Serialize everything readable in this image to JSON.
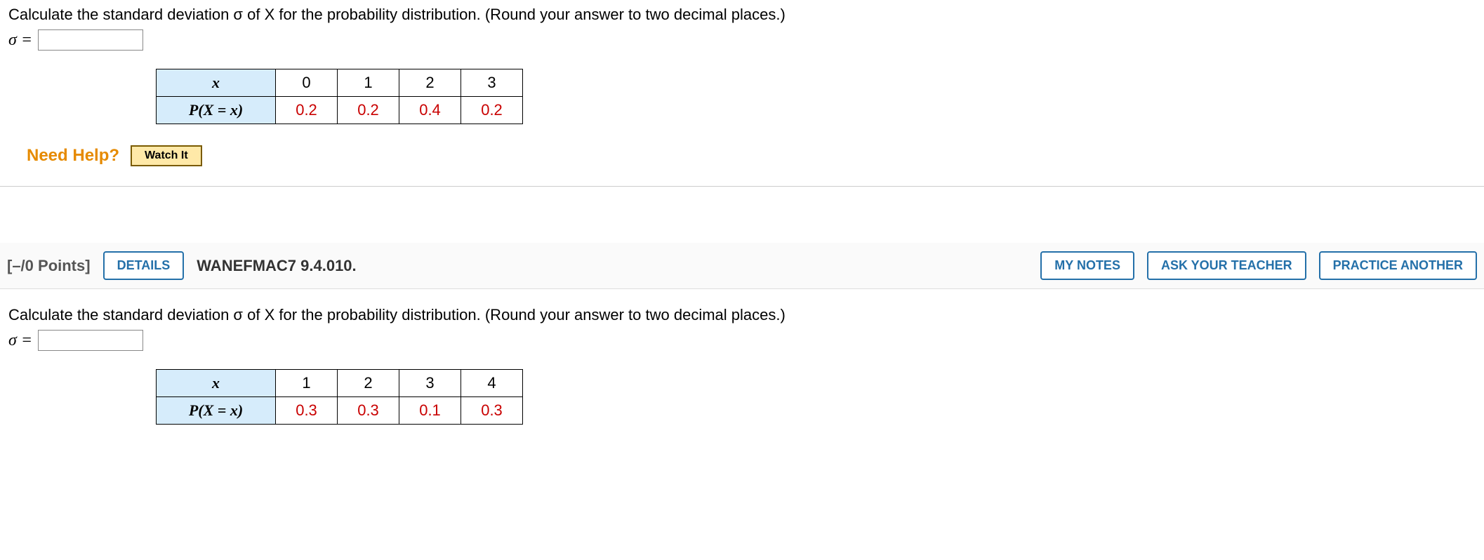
{
  "q1": {
    "prompt": "Calculate the standard deviation σ of X for the probability distribution. (Round your answer to two decimal places.)",
    "sigma_label": "σ =",
    "table": {
      "row1_label": "x",
      "row2_label": "P(X = x)",
      "cols": [
        "0",
        "1",
        "2",
        "3"
      ],
      "probs": [
        "0.2",
        "0.2",
        "0.4",
        "0.2"
      ]
    },
    "need_help": "Need Help?",
    "watch_it": "Watch It"
  },
  "header2": {
    "points": "[–/0 Points]",
    "details": "DETAILS",
    "ref": "WANEFMAC7 9.4.010.",
    "my_notes": "MY NOTES",
    "ask": "ASK YOUR TEACHER",
    "practice": "PRACTICE ANOTHER"
  },
  "q2": {
    "prompt": "Calculate the standard deviation σ of X for the probability distribution. (Round your answer to two decimal places.)",
    "sigma_label": "σ =",
    "table": {
      "row1_label": "x",
      "row2_label": "P(X = x)",
      "cols": [
        "1",
        "2",
        "3",
        "4"
      ],
      "probs": [
        "0.3",
        "0.3",
        "0.1",
        "0.3"
      ]
    }
  }
}
